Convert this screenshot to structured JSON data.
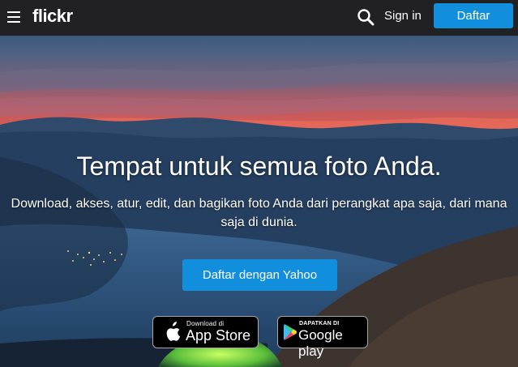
{
  "header": {
    "logo": "flickr",
    "signin_label": "Sign in",
    "signup_label": "Daftar"
  },
  "hero": {
    "title": "Tempat untuk semua foto Anda.",
    "subtitle": "Download, akses, atur, edit, dan bagikan foto Anda dari perangkat apa saja, dari mana saja di dunia.",
    "yahoo_button": "Daftar dengan Yahoo"
  },
  "badges": {
    "appstore_small": "Download di",
    "appstore_big": "App Store",
    "gplay_small": "DAPATKAN DI",
    "gplay_big": "Google play"
  },
  "icons": {
    "menu": "hamburger-icon",
    "search": "search-icon",
    "apple": "apple-icon",
    "gplay": "google-play-icon"
  },
  "colors": {
    "topbar": "#212124",
    "accent": "#128fdc"
  }
}
